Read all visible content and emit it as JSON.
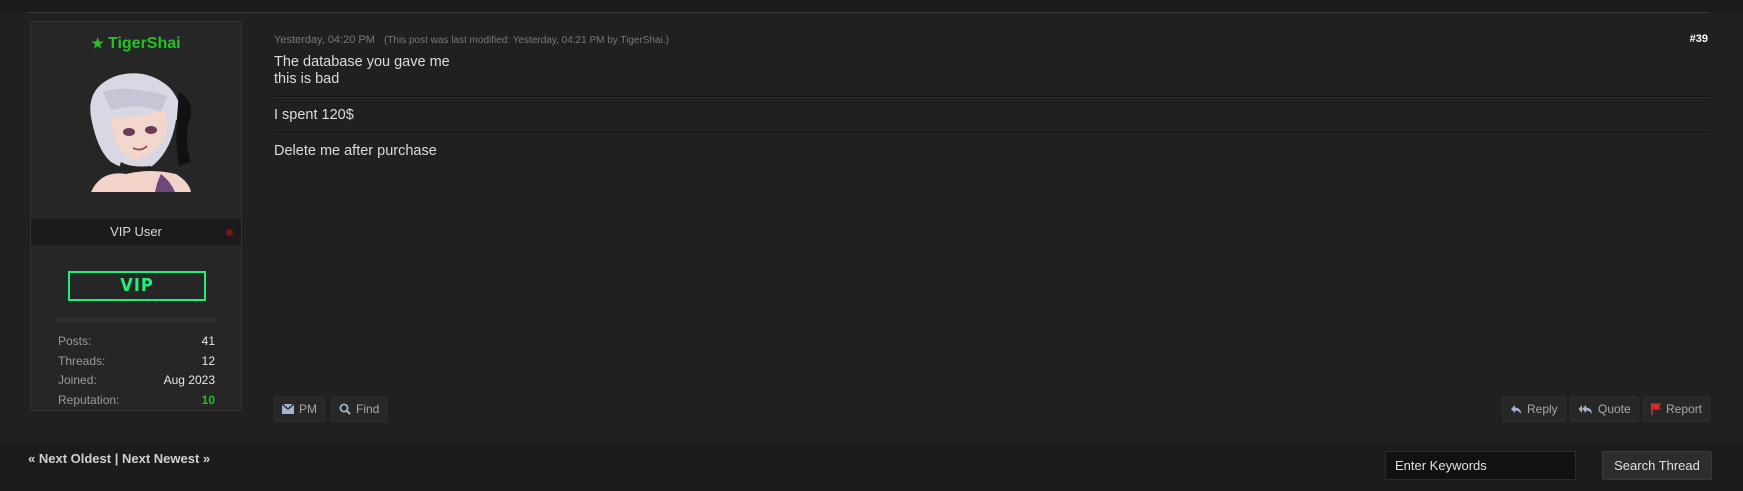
{
  "post": {
    "author": {
      "username": "TigerShai",
      "usertitle": "VIP User",
      "badge": "VIP",
      "stats": [
        {
          "label": "Posts:",
          "value": "41"
        },
        {
          "label": "Threads:",
          "value": "12"
        },
        {
          "label": "Joined:",
          "value": "Aug 2023"
        },
        {
          "label": "Reputation:",
          "value": "10"
        }
      ]
    },
    "date": "Yesterday, 04:20 PM",
    "edit_note": "(This post was last modified: Yesterday, 04:21 PM by TigerShai.)",
    "number": "#39",
    "body": {
      "line1": "The database you gave me",
      "line2": "this is bad",
      "line3": "I spent 120$",
      "line4": "Delete me after purchase"
    },
    "buttons": {
      "pm": "PM",
      "find": "Find",
      "reply": "Reply",
      "quote": "Quote",
      "report": "Report"
    }
  },
  "footer": {
    "next_oldest": "« Next Oldest",
    "separator": "|",
    "next_newest": "Next Newest »",
    "search_placeholder": "Enter Keywords",
    "search_button": "Search Thread"
  },
  "colors": {
    "username": "#21c421",
    "badge": "#1ef07a",
    "report_flag": "#d42a2a"
  }
}
